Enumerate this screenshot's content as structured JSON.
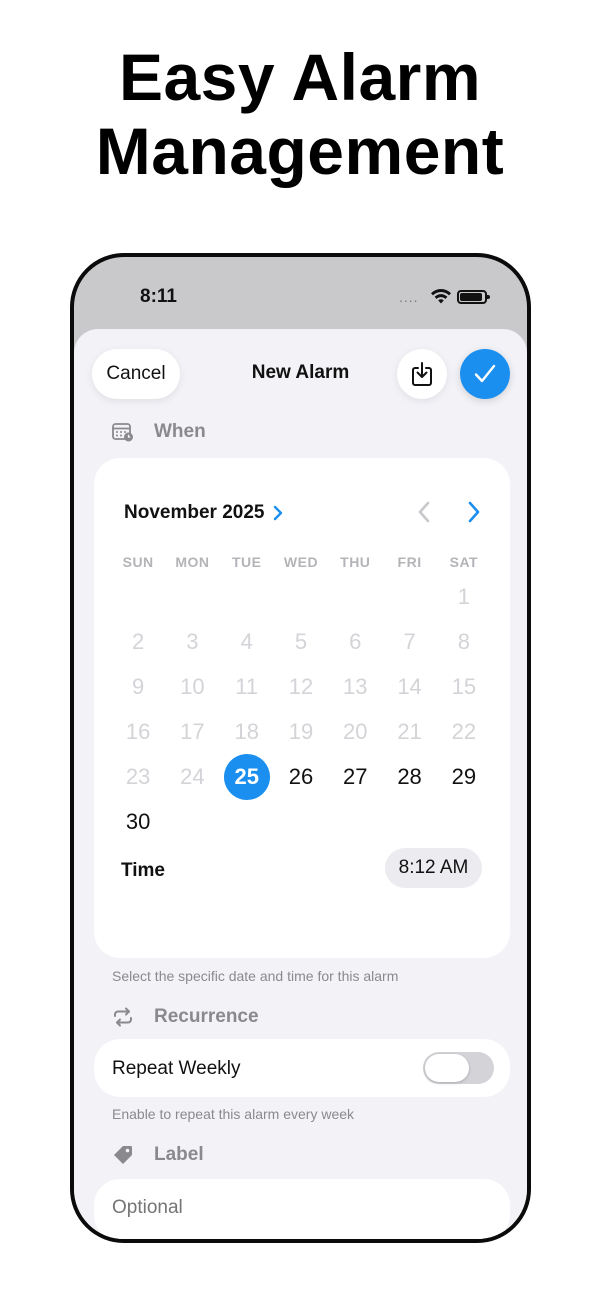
{
  "headline": {
    "line1": "Easy Alarm",
    "line2": "Management"
  },
  "status_bar": {
    "time": "8:11",
    "signal": "....",
    "wifi_icon": "wifi-icon",
    "battery_icon": "battery-icon"
  },
  "nav": {
    "cancel": "Cancel",
    "title": "New Alarm",
    "save_icon": "save-to-device-icon",
    "done_icon": "checkmark-icon"
  },
  "when": {
    "section_label": "When",
    "month_label": "November 2025",
    "weekdays": [
      "SUN",
      "MON",
      "TUE",
      "WED",
      "THU",
      "FRI",
      "SAT"
    ],
    "leading_blanks": 6,
    "days_in_month": 30,
    "first_available_day": 25,
    "selected_day": 25,
    "time_label": "Time",
    "time_value": "8:12 AM",
    "footnote": "Select the specific date and time for this alarm"
  },
  "recurrence": {
    "section_label": "Recurrence",
    "toggle_label": "Repeat Weekly",
    "toggle_on": false,
    "footnote": "Enable to repeat this alarm every week"
  },
  "label": {
    "section_label": "Label",
    "placeholder": "Optional",
    "value": ""
  },
  "colors": {
    "accent": "#1a8ff0",
    "sheet_bg": "#f2f2f7",
    "muted": "#8a8a8e"
  }
}
